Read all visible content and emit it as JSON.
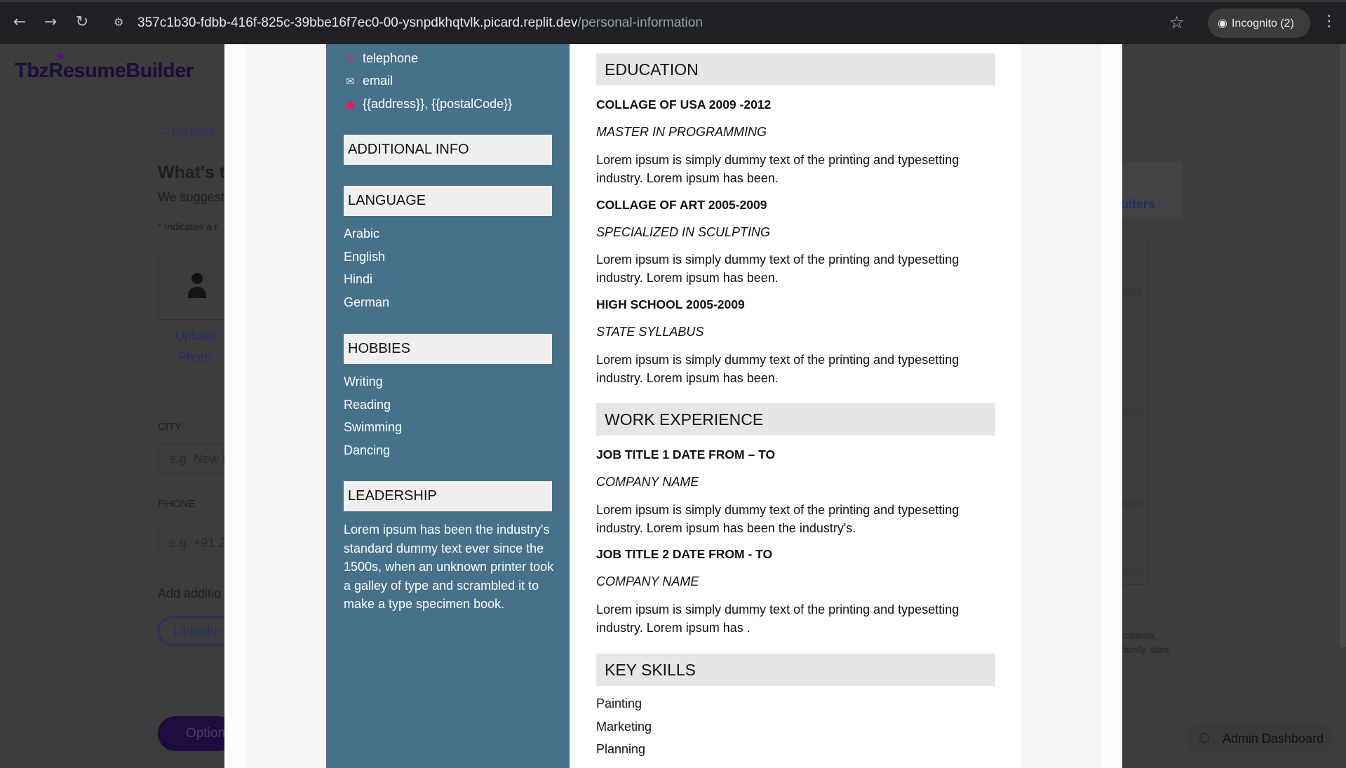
{
  "browser": {
    "url_host": "357c1b30-fdbb-416f-825c-39bbe16f7ec0-00-ysnpdkhqtvlk.picard.replit.dev",
    "url_path": "/personal-information",
    "incognito_label": "Incognito (2)"
  },
  "background": {
    "logo": "TbzResumeBuilder",
    "go_back": "Go Back",
    "heading": "What's t",
    "suggest": "We suggest",
    "required_note": "* Indicates a r",
    "upload_photo_line1": "Upload",
    "upload_photo_line2": "Photo",
    "city_label": "CITY",
    "city_placeholder": "e.g. New D",
    "phone_label": "PHONE",
    "phone_placeholder": "e.g. +91 2",
    "add_additional": "Add additio",
    "linkedin": "LinkedIn",
    "option_button": "Option",
    "recruiters": "uiters",
    "participants_line1": "icipants,",
    "participants_line2": "family sites.",
    "admin_dashboard": "Admin Dashboard"
  },
  "resume": {
    "contact": {
      "telephone": "telephone",
      "email": "email",
      "address": "{{address}}, {{postalCode}}"
    },
    "sidebar": {
      "additional_info": "ADDITIONAL INFO",
      "language_title": "LANGUAGE",
      "languages": [
        "Arabic",
        "English",
        "Hindi",
        "German"
      ],
      "hobbies_title": "HOBBIES",
      "hobbies": [
        "Writing",
        "Reading",
        "Swimming",
        "Dancing"
      ],
      "leadership_title": "LEADERSHIP",
      "leadership_text": "Lorem ipsum has been the industry's standard dummy text ever since the 1500s, when an unknown printer took a galley of type and scrambled it to make a type specimen book."
    },
    "education": {
      "title": "EDUCATION",
      "entries": [
        {
          "school": "COLLAGE OF USA 2009 -2012",
          "degree": "MASTER IN PROGRAMMING",
          "desc": "Lorem ipsum is simply dummy text of the printing and typesetting industry. Lorem ipsum has been."
        },
        {
          "school": "COLLAGE OF ART 2005-2009",
          "degree": "SPECIALIZED IN SCULPTING",
          "desc": "Lorem ipsum is simply dummy text of the printing and typesetting industry. Lorem ipsum has been."
        },
        {
          "school": "HIGH SCHOOL 2005-2009",
          "degree": "STATE SYLLABUS",
          "desc": "Lorem ipsum is simply dummy text of the printing and typesetting industry. Lorem ipsum has been."
        }
      ]
    },
    "work": {
      "title": "WORK EXPERIENCE",
      "entries": [
        {
          "job": "JOB TITLE 1 DATE FROM – TO",
          "company": "COMPANY NAME",
          "desc": "Lorem ipsum is simply dummy text of the printing and typesetting industry. Lorem ipsum has been the industry's."
        },
        {
          "job": "JOB TITLE 2 DATE FROM - TO",
          "company": "COMPANY NAME",
          "desc": "Lorem ipsum is simply dummy text of the printing and typesetting industry. Lorem ipsum has ."
        }
      ]
    },
    "skills": {
      "title": "KEY SKILLS",
      "items": [
        "Painting",
        "Marketing",
        "Planning"
      ]
    }
  },
  "colors": {
    "sidebar": "#47708a",
    "header_bg": "#e6e6e6",
    "brand": "#1e0d3d"
  }
}
